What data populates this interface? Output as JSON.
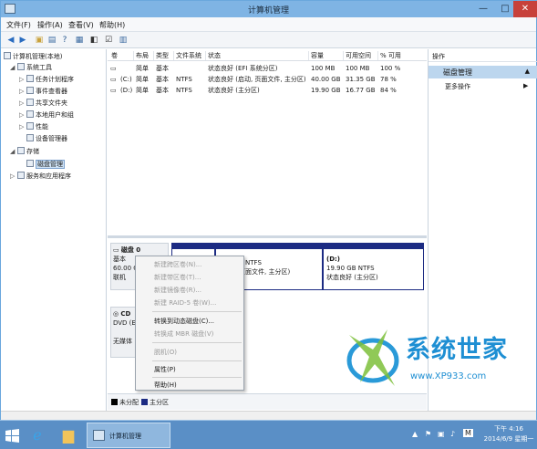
{
  "window": {
    "title": "计算机管理",
    "controls": {
      "minimize": "—",
      "maximize": "□",
      "close": "✕"
    }
  },
  "menu": [
    "文件(F)",
    "操作(A)",
    "查看(V)",
    "帮助(H)"
  ],
  "tree": {
    "root": "计算机管理(本地)",
    "items": [
      "系统工具",
      "任务计划程序",
      "事件查看器",
      "共享文件夹",
      "本地用户和组",
      "性能",
      "设备管理器",
      "存储",
      "磁盘管理",
      "服务和应用程序"
    ]
  },
  "volumes": {
    "headers": [
      "卷",
      "布局",
      "类型",
      "文件系统",
      "状态",
      "容量",
      "可用空间",
      "% 可用"
    ],
    "rows": [
      [
        "",
        "简单",
        "基本",
        "",
        "状态良好 (EFI 系统分区)",
        "100 MB",
        "100 MB",
        "100 %"
      ],
      [
        "(C:)",
        "简单",
        "基本",
        "NTFS",
        "状态良好 (启动, 页面文件, 主分区)",
        "40.00 GB",
        "31.35 GB",
        "78 %"
      ],
      [
        "(D:)",
        "简单",
        "基本",
        "NTFS",
        "状态良好 (主分区)",
        "19.90 GB",
        "16.77 GB",
        "84 %"
      ]
    ]
  },
  "disk0": {
    "name": "磁盘 0",
    "type": "基本",
    "size": "60.00 G",
    "status": "联机",
    "part_c_size": "B NTFS",
    "part_c_status": "主分区)",
    "part_c_status2": "页面文件, 主分区)",
    "part_d_name": "(D:)",
    "part_d_size": "19.90 GB NTFS",
    "part_d_status": "状态良好 (主分区)"
  },
  "cdrom": {
    "name": "CD",
    "drive": "DVD (E:",
    "status": "无媒体"
  },
  "context_menu": {
    "items": [
      {
        "label": "新建跨区卷(N)...",
        "disabled": true
      },
      {
        "label": "新建带区卷(T)...",
        "disabled": true
      },
      {
        "label": "新建镜像卷(R)...",
        "disabled": true
      },
      {
        "label": "新建 RAID-5 卷(W)...",
        "disabled": true
      },
      {
        "label": "转换到动态磁盘(C)...",
        "disabled": false
      },
      {
        "label": "转换成 MBR 磁盘(V)",
        "disabled": true
      },
      {
        "label": "脱机(O)",
        "disabled": true
      },
      {
        "label": "属性(P)",
        "disabled": false
      },
      {
        "label": "帮助(H)",
        "disabled": false
      }
    ]
  },
  "legend": {
    "unallocated": "未分配",
    "primary": "主分区"
  },
  "actions": {
    "header": "操作",
    "section": "磁盘管理",
    "more": "更多操作"
  },
  "watermark": {
    "text": "系统世家",
    "url": "www.XP933.com"
  },
  "taskbar": {
    "active_task": "计算机管理",
    "input_indicator": "M",
    "time": "下午 4:16",
    "date": "2014/6/9 星期一"
  },
  "colors": {
    "partition": "#1c2b83",
    "unallocated": "#000000",
    "selection": "#cfe3f6",
    "taskbar": "#5a8fc6"
  }
}
